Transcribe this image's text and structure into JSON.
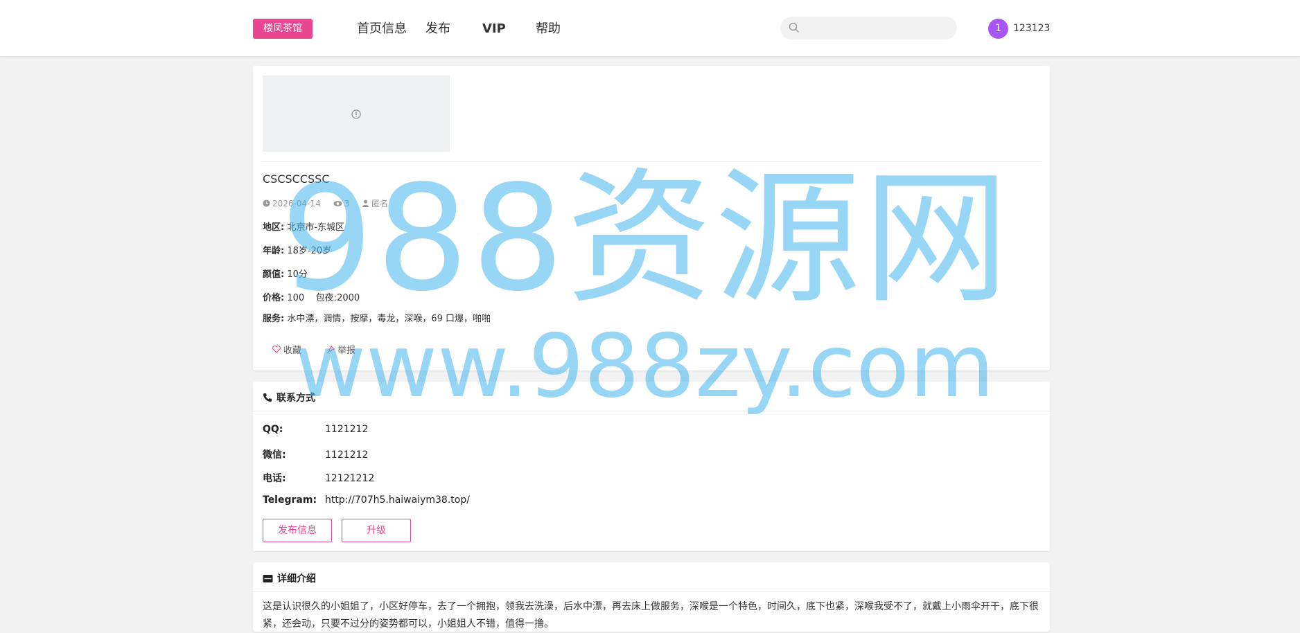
{
  "header": {
    "logo": "楼凤茶馆",
    "nav": [
      "首页信息",
      "发布",
      "VIP",
      "帮助"
    ],
    "search_placeholder": "",
    "avatar_initial": "1",
    "username": "123123"
  },
  "post": {
    "title": "CSCSCCSSC",
    "date": "2026-04-14",
    "views": "3",
    "author": "匿名",
    "fields": [
      {
        "label": "地区:",
        "value": "北京市-东城区"
      },
      {
        "label": "年龄:",
        "value": "18岁-20岁"
      },
      {
        "label": "颜值:",
        "value": "10分"
      },
      {
        "label": "价格:",
        "value": "100    包夜:2000"
      },
      {
        "label": "服务:",
        "value": "水中漂，调情，按摩，毒龙，深喉，69 口爆，啪啪"
      }
    ],
    "favorite_label": "收藏",
    "report_label": "举报"
  },
  "contact": {
    "title": "联系方式",
    "rows": [
      {
        "label": "QQ:",
        "value": "1121212"
      },
      {
        "label": "微信:",
        "value": "1121212"
      },
      {
        "label": "电话:",
        "value": "12121212"
      },
      {
        "label": "Telegram:",
        "value": "http://707h5.haiwaiym38.top/"
      }
    ],
    "publish_button": "发布信息",
    "upgrade_button": "升级"
  },
  "details": {
    "title": "详细介绍",
    "text": "这是认识很久的小姐姐了，小区好停车，去了一个拥抱，领我去洗澡，后水中漂，再去床上做服务，深喉是一个特色，时间久，底下也紧，深喉我受不了，就戴上小雨伞开干，底下很紧，还会动，只要不过分的姿势都可以，小姐姐人不错，值得一撸。"
  },
  "watermark": {
    "line1": "988资源网",
    "line2": "www.988zy.com"
  },
  "colors": {
    "brand": "#e8468f",
    "avatar": "#a855f7",
    "watermark": "#43b4ee"
  }
}
